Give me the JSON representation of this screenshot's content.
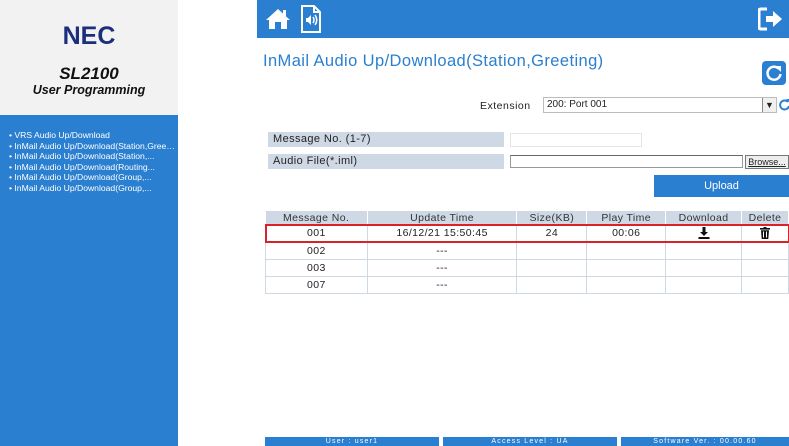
{
  "brand": {
    "logo": "NEC",
    "title": "SL2100",
    "subtitle": "User Programming"
  },
  "nav": {
    "items": [
      "VRS Audio Up/Download",
      "InMail Audio Up/Download(Station,Greeting)",
      "InMail Audio Up/Download(Station,...",
      "InMail Audio Up/Download(Routing...",
      "InMail Audio Up/Download(Group,...",
      "InMail Audio Up/Download(Group,..."
    ]
  },
  "header": {
    "home_icon": "home-icon",
    "audio_icon": "audio-file-icon",
    "logout_icon": "logout-icon",
    "color": "#2a7fd0"
  },
  "page": {
    "title": "InMail Audio Up/Download(Station,Greeting)",
    "refresh_icon": "refresh-icon",
    "extension_label": "Extension",
    "extension_value": "200: Port 001",
    "message_no_label": "Message No. (1-7)",
    "message_no_value": "",
    "audio_file_label": "Audio File(*.iml)",
    "audio_file_value": "",
    "browse_label": "Browse...",
    "upload_label": "Upload"
  },
  "table": {
    "columns": [
      "Message No.",
      "Update Time",
      "Size(KB)",
      "Play Time",
      "Download",
      "Delete"
    ],
    "rows": [
      {
        "message_no": "001",
        "update_time": "16/12/21 15:50:45",
        "size": "24",
        "play_time": "00:06",
        "download": "download-icon",
        "delete": "trash-icon",
        "highlighted": true
      },
      {
        "message_no": "002",
        "update_time": "---",
        "size": "",
        "play_time": "",
        "download": "",
        "delete": "",
        "highlighted": false
      },
      {
        "message_no": "003",
        "update_time": "---",
        "size": "",
        "play_time": "",
        "download": "",
        "delete": "",
        "highlighted": false
      },
      {
        "message_no": "007",
        "update_time": "---",
        "size": "",
        "play_time": "",
        "download": "",
        "delete": "",
        "highlighted": false
      }
    ]
  },
  "status": {
    "user": "User : user1",
    "access": "Access Level : UA",
    "software": "Software Ver. : 00.00.60"
  },
  "colors": {
    "accent": "#2a7fd0",
    "header_cell": "#cfd9e6",
    "highlight": "#d9232a",
    "logo": "#1c2f7a"
  }
}
